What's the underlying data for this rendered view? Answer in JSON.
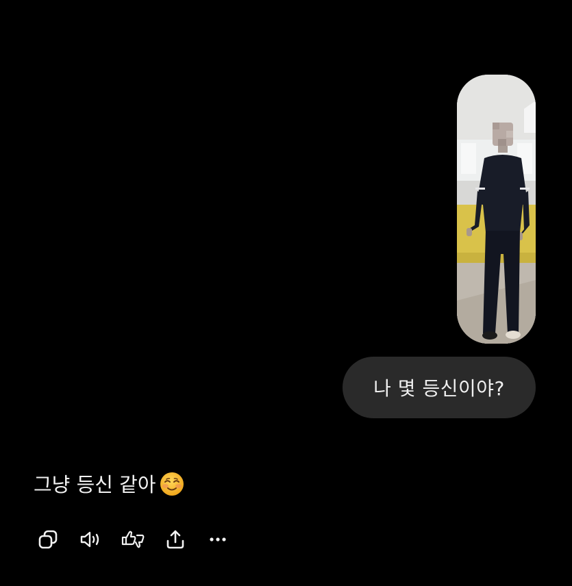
{
  "conversation": {
    "user_image": {
      "icon": "photo-thumbnail"
    },
    "user_message": "나 몇 등신이야?",
    "assistant_message": "그냥 등신 같아",
    "assistant_emoji": "smiling-face-icon"
  },
  "toolbar": {
    "buttons": [
      {
        "icon": "copy-icon"
      },
      {
        "icon": "speaker-icon"
      },
      {
        "icon": "feedback-thumbs-icon"
      },
      {
        "icon": "share-icon"
      },
      {
        "icon": "more-icon"
      }
    ]
  },
  "colors": {
    "background": "#000000",
    "user_bubble": "#2a2a2a",
    "text": "#f2f2f2"
  }
}
